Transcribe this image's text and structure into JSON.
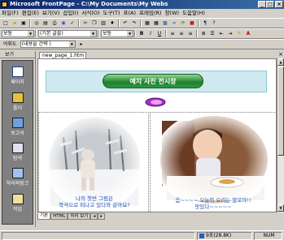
{
  "window": {
    "title": "Microsoft FrontPage - C:\\My Documents\\My Webs"
  },
  "menu": [
    "파일(F)",
    "편집(E)",
    "보기(V)",
    "삽입(I)",
    "서식(O)",
    "도구(T)",
    "표(A)",
    "프레임(R)",
    "창(W)",
    "도움말(H)"
  ],
  "toolbar2": {
    "style_value": "보통",
    "font_value": "(기본 글꼴)",
    "size_value": "보통"
  },
  "toolbar3": {
    "label": "어휘도",
    "style_value": "(내용을 간략 )"
  },
  "views_panel": {
    "header": "보기",
    "items": [
      "페이지",
      "폴더",
      "보고서",
      "탐색",
      "하이퍼링크",
      "작업"
    ]
  },
  "document_tab": "new_page_1.htm",
  "page": {
    "banner_title": "예지 사진 전시장",
    "left_caption": "나의 첫번 그림은\n북극으로 떠나고 있다와 같아요?",
    "right_caption": "음~~~~ 오늘의 요리는 말로야!!\n맛있다~~~~~"
  },
  "view_tabs": [
    "기본",
    "HTML",
    "미리 보기"
  ],
  "status": {
    "time": "9초(28.8K)",
    "mode": "NUM"
  },
  "colors": {
    "titlebar": "#0a246a",
    "banner_bg": "#cfe9ef",
    "banner_title": "#1f7f2f",
    "caption": "#1c4fb0"
  }
}
